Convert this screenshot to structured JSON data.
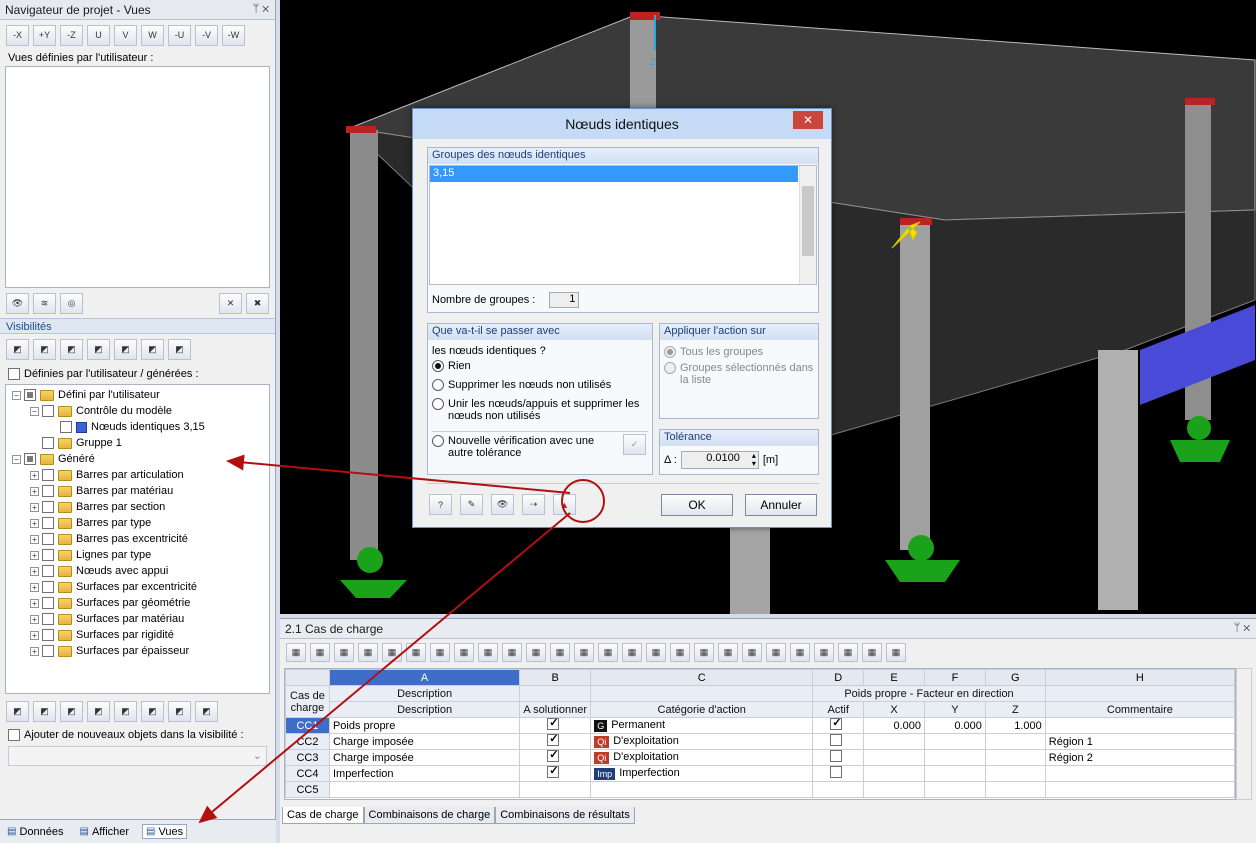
{
  "navigator": {
    "title": "Navigateur de projet - Vues",
    "pin": "ᛘ ✕",
    "user_views_label": "Vues définies par l'utilisateur :",
    "top_toolbar": [
      "-X",
      "+Y",
      "-Z",
      "U",
      "V",
      "W",
      "-U",
      "-V",
      "-W"
    ],
    "visibilities": {
      "header": "Visibilités",
      "checkbox_label": "Définies par l'utilisateur / générées :"
    },
    "tree": [
      {
        "level": 0,
        "exp": "−",
        "cb": "part",
        "folder": true,
        "label": "Défini par l'utilisateur"
      },
      {
        "level": 1,
        "exp": "−",
        "cb": "",
        "folder": true,
        "label": "Contrôle du modèle"
      },
      {
        "level": 2,
        "exp": "",
        "cb": "",
        "blue": true,
        "label": "Nœuds identiques 3,15"
      },
      {
        "level": 1,
        "exp": "",
        "cb": "",
        "folder": true,
        "label": "Gruppe 1"
      },
      {
        "level": 0,
        "exp": "−",
        "cb": "part",
        "folder": true,
        "label": "Généré"
      },
      {
        "level": 1,
        "exp": "+",
        "cb": "",
        "folder": true,
        "label": "Barres par articulation"
      },
      {
        "level": 1,
        "exp": "+",
        "cb": "",
        "folder": true,
        "label": "Barres par matériau"
      },
      {
        "level": 1,
        "exp": "+",
        "cb": "",
        "folder": true,
        "label": "Barres par section"
      },
      {
        "level": 1,
        "exp": "+",
        "cb": "",
        "folder": true,
        "label": "Barres par type"
      },
      {
        "level": 1,
        "exp": "+",
        "cb": "",
        "folder": true,
        "label": "Barres pas excentricité"
      },
      {
        "level": 1,
        "exp": "+",
        "cb": "",
        "folder": true,
        "label": "Lignes par type"
      },
      {
        "level": 1,
        "exp": "+",
        "cb": "",
        "folder": true,
        "label": "Nœuds avec appui"
      },
      {
        "level": 1,
        "exp": "+",
        "cb": "",
        "folder": true,
        "label": "Surfaces par excentricité"
      },
      {
        "level": 1,
        "exp": "+",
        "cb": "",
        "folder": true,
        "label": "Surfaces par géométrie"
      },
      {
        "level": 1,
        "exp": "+",
        "cb": "",
        "folder": true,
        "label": "Surfaces par matériau"
      },
      {
        "level": 1,
        "exp": "+",
        "cb": "",
        "folder": true,
        "label": "Surfaces par rigidité"
      },
      {
        "level": 1,
        "exp": "+",
        "cb": "",
        "folder": true,
        "label": "Surfaces par épaisseur"
      }
    ],
    "add_objects_label": "Ajouter de nouveaux objets dans la visibilité :",
    "bottom_tabs": [
      "Données",
      "Afficher",
      "Vues"
    ]
  },
  "viewport": {
    "axis_label": "Z"
  },
  "dialog": {
    "title": "Nœuds identiques",
    "close": "✕",
    "groups_header": "Groupes des nœuds identiques",
    "groups": [
      "3,15"
    ],
    "count_label": "Nombre de groupes :",
    "count_value": "1",
    "what_header": "Que va-t-il se passer avec",
    "what_sub": "les nœuds identiques ?",
    "options": [
      "Rien",
      "Supprimer les nœuds non utilisés",
      "Unir les nœuds/appuis et supprimer les nœuds non utilisés",
      "Nouvelle vérification avec une autre tolérance"
    ],
    "apply_header": "Appliquer l'action sur",
    "apply_options": [
      "Tous les groupes",
      "Groupes sélectionnés dans la liste"
    ],
    "tol_header": "Tolérance",
    "tol_symbol": "Δ :",
    "tol_value": "0.0100",
    "tol_unit": "[m]",
    "ok": "OK",
    "cancel": "Annuler"
  },
  "loadcases": {
    "title": "2.1 Cas de charge",
    "pin": "ᛘ ✕",
    "col_letters": [
      "A",
      "B",
      "C",
      "D",
      "E",
      "F",
      "G",
      "H"
    ],
    "head_row1": {
      "id": "Cas de",
      "A": "Description",
      "weight": "Poids propre - Facteur en direction"
    },
    "head_row2": {
      "id": "charge",
      "A": "Description",
      "B": "A solutionner",
      "C": "Catégorie d'action",
      "D": "Actif",
      "E": "X",
      "F": "Y",
      "G": "Z",
      "H": "Commentaire"
    },
    "rows": [
      {
        "id": "CC1",
        "desc": "Poids propre",
        "solve": true,
        "badge": "G",
        "badge_color": "#111111",
        "cat": "Permanent",
        "active": true,
        "x": "0.000",
        "y": "0.000",
        "z": "1.000",
        "comment": ""
      },
      {
        "id": "CC2",
        "desc": "Charge imposée",
        "solve": true,
        "badge": "Qi",
        "badge_color": "#c0392b",
        "cat": "D'exploitation",
        "active": false,
        "x": "",
        "y": "",
        "z": "",
        "comment": "Région 1"
      },
      {
        "id": "CC3",
        "desc": "Charge imposée",
        "solve": true,
        "badge": "Qi",
        "badge_color": "#c0392b",
        "cat": "D'exploitation",
        "active": false,
        "x": "",
        "y": "",
        "z": "",
        "comment": "Région 2"
      },
      {
        "id": "CC4",
        "desc": "Imperfection",
        "solve": true,
        "badge": "Imp",
        "badge_color": "#1f3f7a",
        "cat": "Imperfection",
        "active": false,
        "x": "",
        "y": "",
        "z": "",
        "comment": ""
      },
      {
        "id": "CC5",
        "desc": "",
        "solve": false,
        "badge": "",
        "badge_color": "",
        "cat": "",
        "active": null,
        "x": "",
        "y": "",
        "z": "",
        "comment": ""
      }
    ],
    "tabs": [
      "Cas de charge",
      "Combinaisons de charge",
      "Combinaisons de résultats"
    ]
  },
  "colors": {
    "accent": "#3f6ec9",
    "annotation": "#b01010",
    "support": "#1aa31a",
    "beam": "#4a4ad8"
  }
}
